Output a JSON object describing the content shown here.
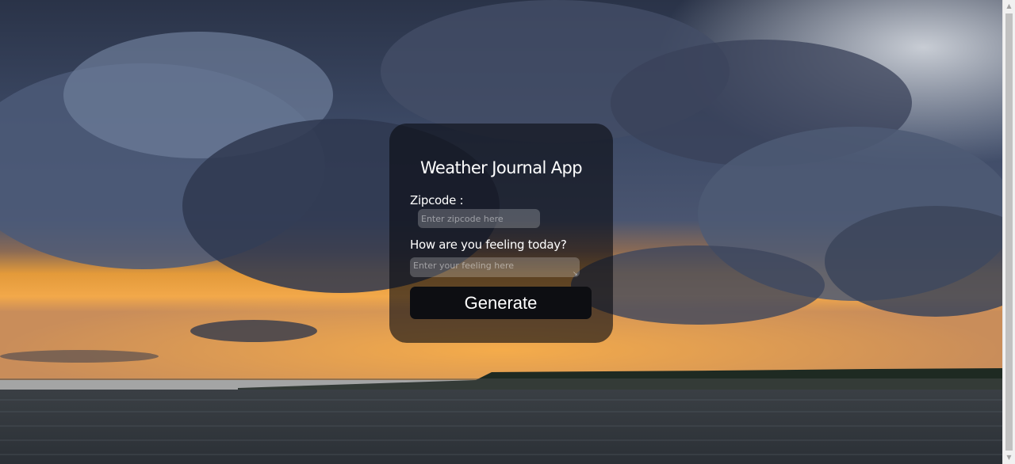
{
  "app": {
    "title": "Weather Journal App"
  },
  "form": {
    "zip_label": "Zipcode :",
    "zip_placeholder": "Enter zipcode here",
    "zip_value": "",
    "feeling_label": "How are you feeling today?",
    "feeling_placeholder": "Enter your feeling here",
    "feeling_value": "",
    "generate_label": "Generate"
  },
  "colors": {
    "card_background": "#0a0c12",
    "button_background": "#0d0e12",
    "text": "#ffffff"
  },
  "icons": {
    "scroll_up": "triangle-up-icon",
    "scroll_down": "triangle-down-icon",
    "resize": "resize-grip-icon"
  }
}
